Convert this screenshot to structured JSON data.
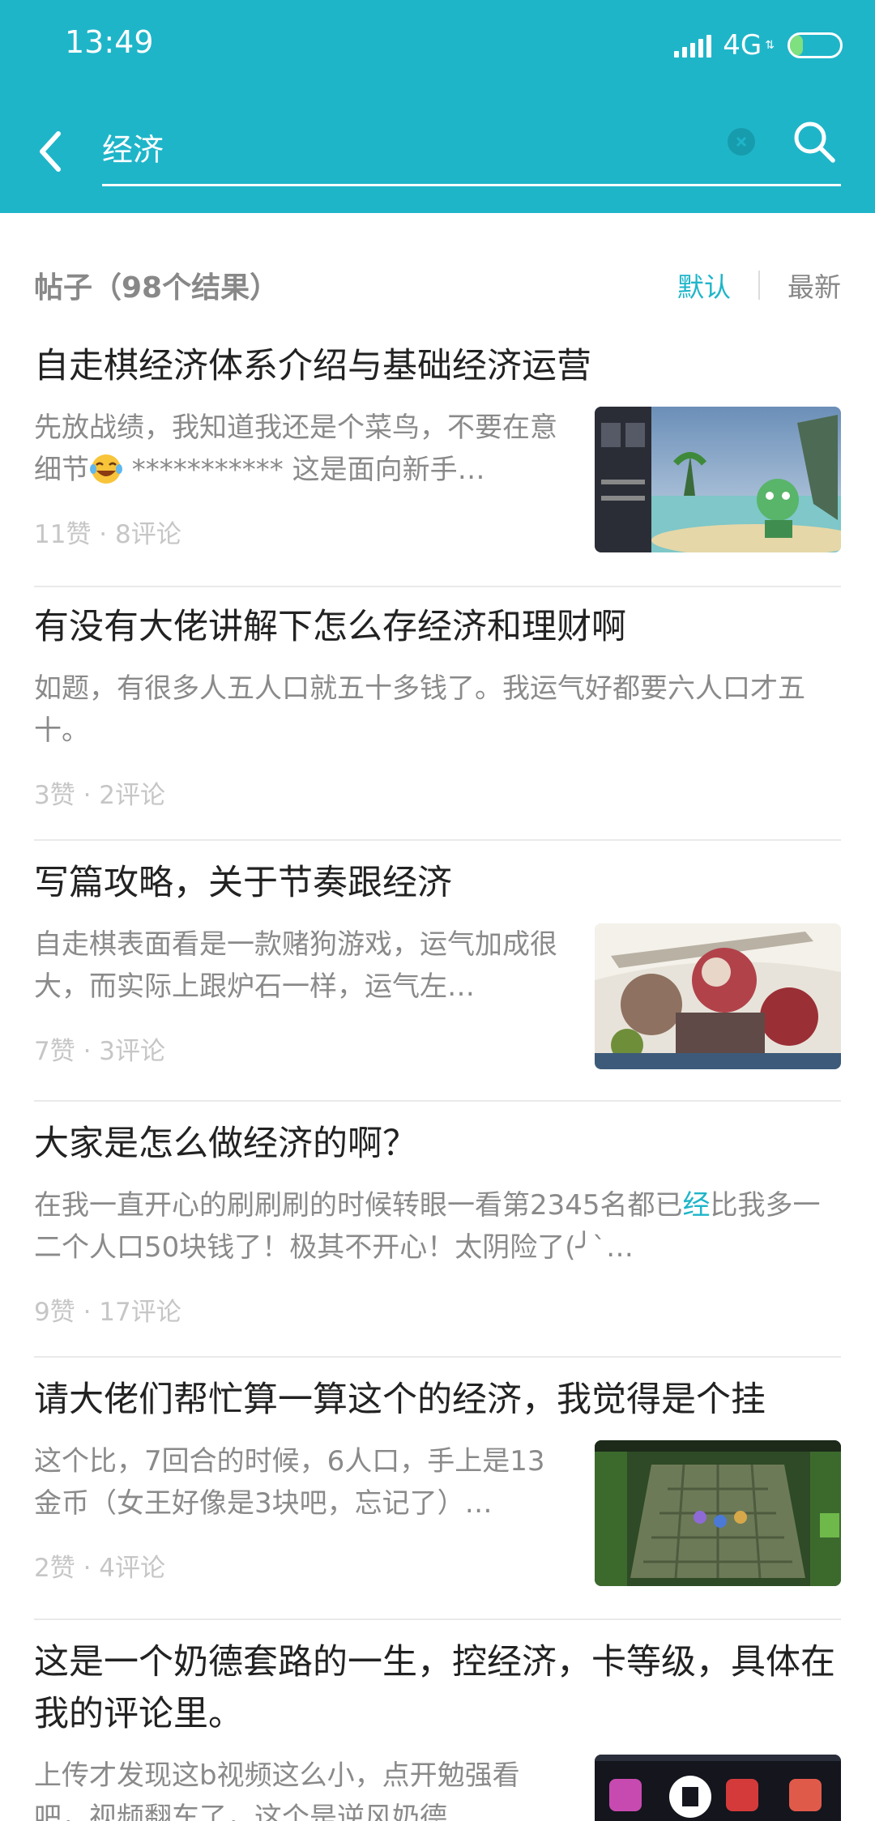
{
  "status_bar": {
    "time": "13:49",
    "network": "4G",
    "battery": 26,
    "battery_level": "26"
  },
  "search": {
    "query": "经济"
  },
  "section": {
    "title": "帖子（98个结果）",
    "sort_default": "默认",
    "sort_newest": "最新"
  },
  "posts": [
    {
      "title": "自走棋经济体系介绍与基础经济运营",
      "excerpt_a": "先放战绩，我知道我还是个菜鸟，不要在意细节",
      "excerpt_b": " *********** 这是面向新手…",
      "likes": "11赞",
      "comments": "8评论",
      "thumbnail": "game-board-screenshot"
    },
    {
      "title": "有没有大佬讲解下怎么存经济和理财啊",
      "excerpt": "如题，有很多人五人口就五十多钱了。我运气好都要六人口才五十。",
      "likes": "3赞",
      "comments": "2评论"
    },
    {
      "title": "写篇攻略，关于节奏跟经济",
      "excerpt": "自走棋表面看是一款赌狗游戏，运气加成很大，而实际上跟炉石一样，运气左…",
      "likes": "7赞",
      "comments": "3评论",
      "thumbnail": "game-art-battle"
    },
    {
      "title": "大家是怎么做经济的啊？",
      "excerpt_a": "在我一直开心的刷刷刷的时候转眼一看第2345名都已",
      "excerpt_hl": "经",
      "excerpt_b": "比我多一二个人口50块钱了！极其不开心！太阴险了(╯`…",
      "likes": "9赞",
      "comments": "17评论"
    },
    {
      "title": "请大佬们帮忙算一算这个的经济，我觉得是个挂",
      "excerpt": "这个比，7回合的时候，6人口，手上是13金币（女王好像是3块吧，忘记了）…",
      "likes": "2赞",
      "comments": "4评论",
      "thumbnail": "game-chessboard"
    },
    {
      "title": "这是一个奶德套路的一生，控经济，卡等级，具体在我的评论里。",
      "excerpt": "上传才发现这b视频这么小，点开勉强看吧，视频翻车了，这个是逆风奶德…",
      "thumbnail": "game-heroes-icons"
    }
  ],
  "colors": {
    "accent": "#1fb5c9",
    "title": "#222222",
    "excerpt": "#8a8a8a",
    "stats": "#c6c6c6"
  }
}
